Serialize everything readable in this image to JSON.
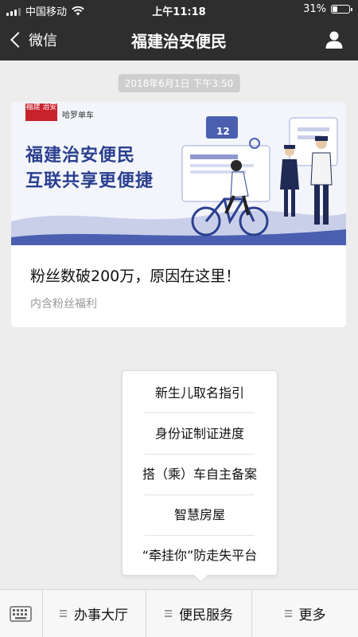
{
  "statusbar": {
    "carrier": "中国移动",
    "time": "上午11:18",
    "battery": "31%",
    "battery_level": 0.31
  },
  "navbar": {
    "back_label": "微信",
    "title": "福建治安便民"
  },
  "timestamp": "2018年6月1日 下午3:50",
  "article": {
    "banner_line1": "福建治安便民",
    "banner_line2": "互联共享更便捷",
    "banner_logo": "福建 治安",
    "banner_partner": "哈罗单车",
    "banner_street_sign": "12",
    "title": "粉丝数破200万，原因在这里！",
    "subtitle": "内含粉丝福利"
  },
  "popup_menu": {
    "items": [
      "新生儿取名指引",
      "身份证制证进度",
      "搭（乘）车自主备案",
      "智慧房屋",
      "“牵挂你”防走失平台"
    ]
  },
  "bottom_menu": {
    "tabs": [
      "办事大厅",
      "便民服务",
      "更多"
    ]
  }
}
